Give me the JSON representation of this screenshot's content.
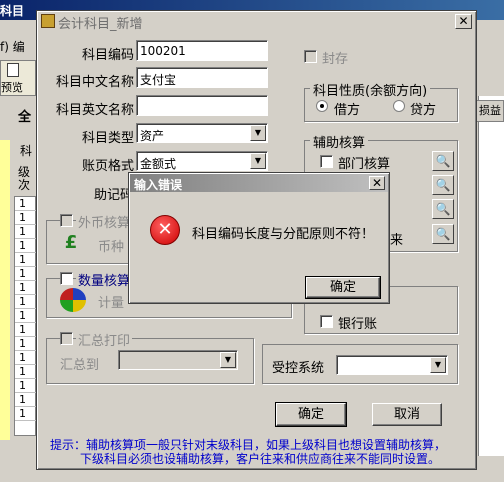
{
  "background_app": {
    "title_fragment": "科目",
    "menu_fragment": "f) 编",
    "toolbar_preview": "预览",
    "tab_fragment": "全",
    "grid_header": "科",
    "grid_header2": "级次",
    "row_value": "1",
    "right_header": "损益"
  },
  "dialog": {
    "title": "会计科目_新增",
    "close_label": "✕",
    "fields": {
      "code_label": "科目编码",
      "code_value": "100201",
      "cn_name_label": "科目中文名称",
      "cn_name_value": "支付宝",
      "en_name_label": "科目英文名称",
      "en_name_value": "",
      "type_label": "科目类型",
      "type_value": "资产",
      "ledger_label": "账页格式",
      "ledger_value": "金额式",
      "mnemonic_label": "助记码"
    },
    "sealed_label": "封存",
    "nature": {
      "title": "科目性质(余额方向)",
      "debit": "借方",
      "credit": "贷方"
    },
    "aux": {
      "title": "辅助核算",
      "dept": "部门核算",
      "bank": "银行账",
      "fragment": "来"
    },
    "foreign": {
      "title": "外币核算",
      "currency": "币种"
    },
    "quantity": {
      "title": "数量核算",
      "unit": "计量"
    },
    "summary": {
      "title": "汇总打印",
      "to_label": "汇总到",
      "to_value": ""
    },
    "controlled": {
      "label": "受控系统",
      "value": ""
    },
    "ok_label": "确定",
    "cancel_label": "取消",
    "hint_line1": "提示：辅助核算项一般只针对末级科目，如果上级科目也想设置辅助核算，",
    "hint_line2": "下级科目必须也设辅助核算，客户往来和供应商往来不能同时设置。"
  },
  "error_dialog": {
    "title": "输入错误",
    "close_label": "✕",
    "icon_glyph": "✕",
    "message": "科目编码长度与分配原则不符！",
    "ok_label": "确定"
  },
  "icons": {
    "magnifier": "🔍"
  }
}
